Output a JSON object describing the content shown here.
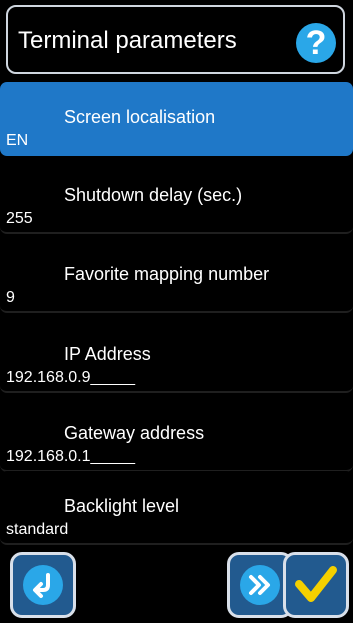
{
  "header": {
    "title": "Terminal parameters",
    "help_icon": "help-question-icon",
    "help_glyph": "?"
  },
  "settings": [
    {
      "label": "Screen localisation",
      "value": "EN",
      "selected": true
    },
    {
      "label": "Shutdown delay (sec.)",
      "value": "255",
      "selected": false
    },
    {
      "label": "Favorite mapping number",
      "value": "9",
      "selected": false
    },
    {
      "label": "IP Address",
      "value": "192.168.0.9_____",
      "selected": false
    },
    {
      "label": "Gateway address",
      "value": "192.168.0.1_____",
      "selected": false
    },
    {
      "label": "Backlight level",
      "value": "standard",
      "selected": false
    }
  ],
  "footer": {
    "back_icon": "return-arrow-icon",
    "next_icon": "double-chevron-right-icon",
    "ok_icon": "checkmark-icon"
  },
  "colors": {
    "background": "#000000",
    "selected_row": "#1f78c8",
    "accent_blue": "#2aa7e8",
    "button_bg": "#225a8f",
    "check_yellow": "#f4d000"
  }
}
